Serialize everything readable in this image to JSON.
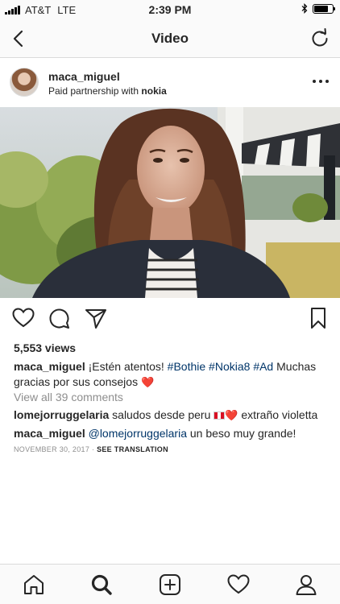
{
  "status_bar": {
    "carrier": "AT&T",
    "network": "LTE",
    "time": "2:39 PM",
    "battery_level": 0.75
  },
  "nav": {
    "title": "Video"
  },
  "post": {
    "username": "maca_miguel",
    "partnership_prefix": "Paid partnership with ",
    "partner": "nokia",
    "views": "5,553 views",
    "caption": {
      "username": "maca_miguel",
      "text_before": "¡Estén atentos! ",
      "tags": [
        "#Bothie",
        "#Nokia8",
        "#Ad"
      ],
      "text_after": " Muchas gracias por sus consejos ",
      "emoji": "❤️"
    },
    "view_comments": "View all 39 comments",
    "comments": [
      {
        "username": "lomejorruggelaria",
        "text": "saludos desde peru",
        "emoji": "❤️",
        "text_after": " extraño violetta"
      },
      {
        "username": "maca_miguel",
        "mention": "@lomejorruggelaria",
        "text": " un beso muy grande!"
      }
    ],
    "date": "NOVEMBER 30, 2017",
    "separator": " · ",
    "see_translation": "SEE TRANSLATION"
  },
  "icons": {
    "back": "chevron-left-icon",
    "refresh": "refresh-icon",
    "more": "more-dots-icon",
    "like": "heart-icon",
    "comment": "comment-bubble-icon",
    "share": "paper-plane-icon",
    "save": "bookmark-icon",
    "home": "home-icon",
    "search": "search-icon",
    "add": "add-post-icon",
    "activity": "heart-icon",
    "profile": "profile-icon"
  }
}
